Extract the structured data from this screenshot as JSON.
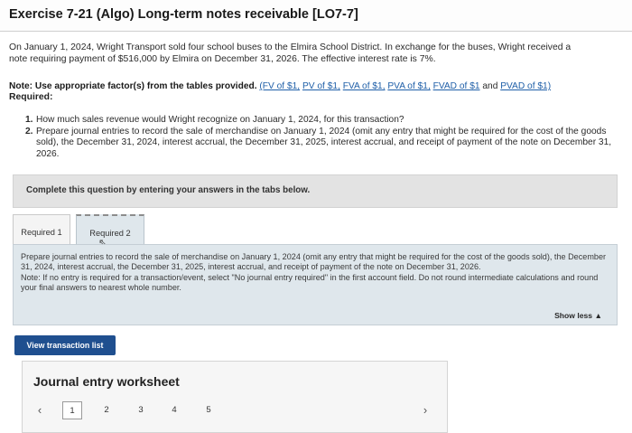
{
  "header": {
    "title": "Exercise 7-21 (Algo) Long-term notes receivable [LO7-7]"
  },
  "problem": {
    "line1": "On January 1, 2024, Wright Transport sold four school buses to the Elmira School District. In exchange for the buses, Wright received a",
    "line2": "note requiring payment of $516,000 by Elmira on December 31, 2026. The effective interest rate is 7%."
  },
  "note": {
    "label": "Note: Use appropriate factor(s) from the tables provided.",
    "links": [
      "(FV of $1,",
      "PV of $1,",
      "FVA of $1,",
      "PVA of $1,",
      "FVAD of $1",
      "and",
      "PVAD of $1)"
    ]
  },
  "required_label": "Required:",
  "requirements": [
    {
      "num": "1.",
      "text": "How much sales revenue would Wright recognize on January 1, 2024, for this transaction?"
    },
    {
      "num": "2.",
      "text": "Prepare journal entries to record the sale of merchandise on January 1, 2024 (omit any entry that might be required for the cost of the goods sold), the December 31, 2024, interest accrual, the December 31, 2025, interest accrual, and receipt of payment of the note on December 31, 2026."
    }
  ],
  "banner": {
    "text": "Complete this question by entering your answers in the tabs below."
  },
  "tabs": [
    {
      "label": "Required 1"
    },
    {
      "label": "Required 2"
    }
  ],
  "panel": {
    "instruction": "Prepare journal entries to record the sale of merchandise on January 1, 2024 (omit any entry that might be required for the cost of the goods sold), the December 31, 2024, interest accrual, the December 31, 2025, interest accrual, and receipt of payment of the note on December 31, 2026.",
    "note": "Note: If no entry is required for a transaction/event, select \"No journal entry required\" in the first account field. Do not round intermediate calculations and round your final answers to nearest whole number.",
    "show_less": "Show less ▲"
  },
  "buttons": {
    "view_transaction_list": "View transaction list"
  },
  "worksheet": {
    "title": "Journal entry worksheet",
    "pages": [
      "1",
      "2",
      "3",
      "4",
      "5"
    ],
    "active_page": "1",
    "prev_icon": "chevron-left-icon",
    "next_icon": "chevron-right-icon"
  }
}
